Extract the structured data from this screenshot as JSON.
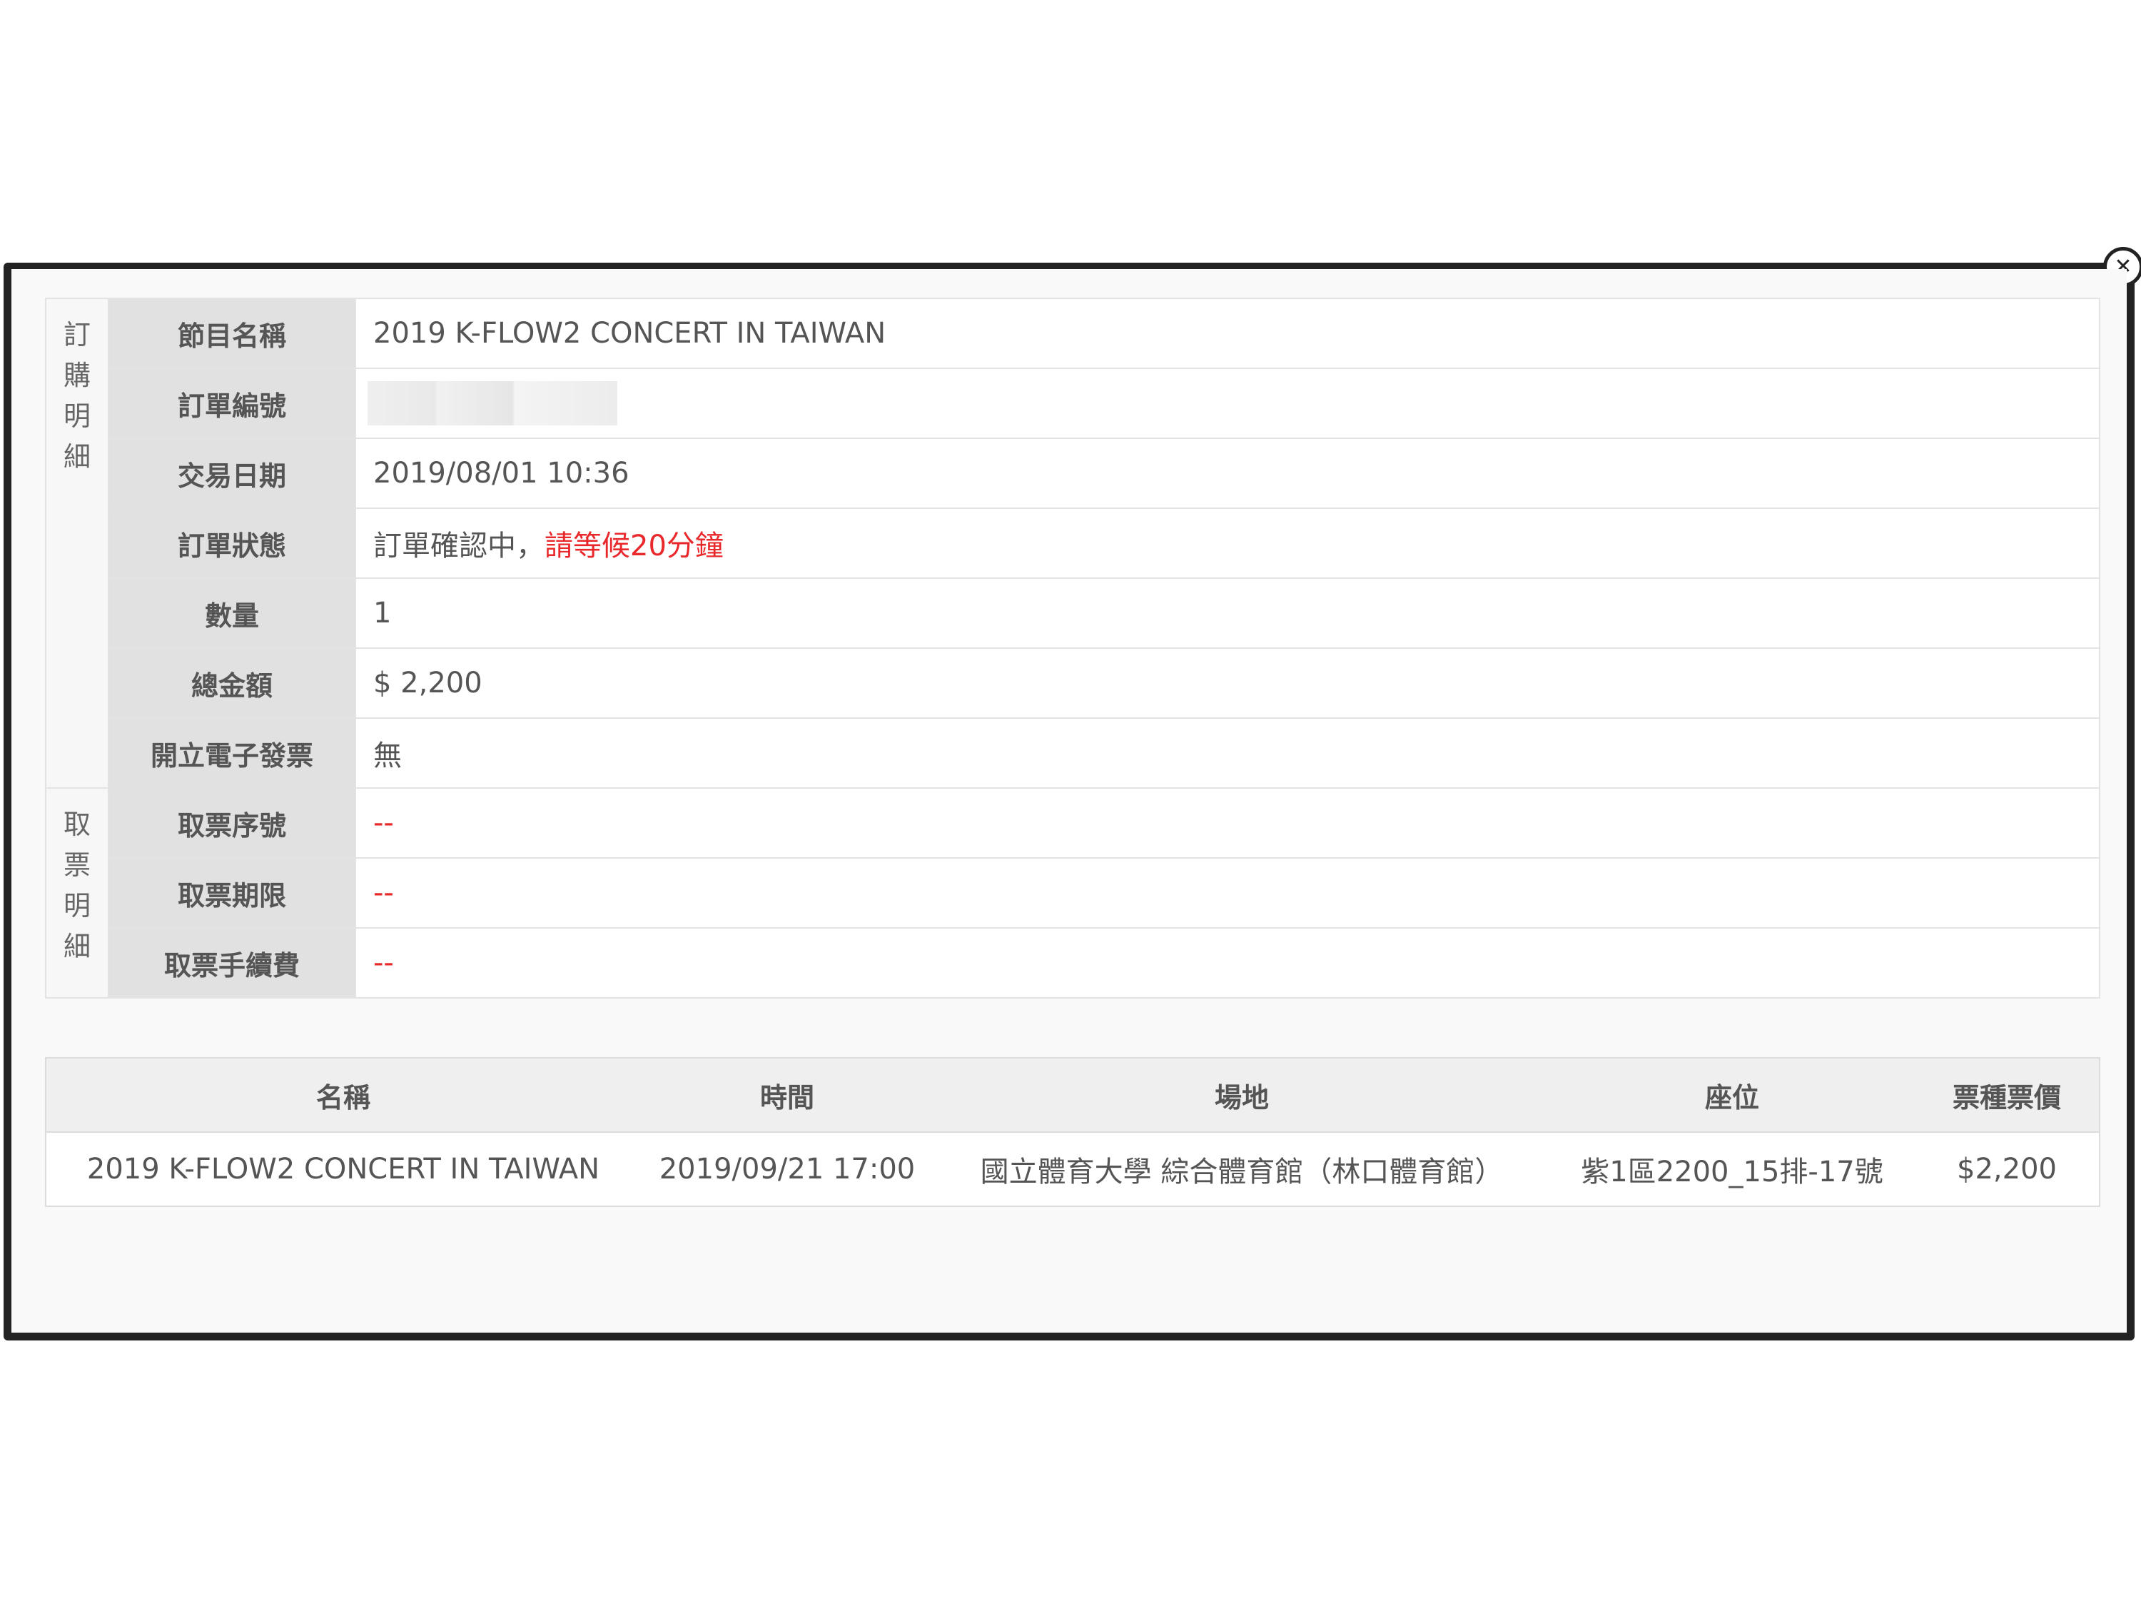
{
  "order": {
    "group_label_chars": [
      "訂",
      "購",
      "明",
      "細"
    ],
    "program_label": "節目名稱",
    "program_value": "2019 K-FLOW2 CONCERT IN TAIWAN",
    "order_no_label": "訂單編號",
    "date_label": "交易日期",
    "date_value": "2019/08/01 10:36",
    "status_label": "訂單狀態",
    "status_value": "訂單確認中，",
    "status_wait": "請等候20分鐘",
    "qty_label": "數量",
    "qty_value": "1",
    "total_label": "總金額",
    "total_value": "$ 2,200",
    "invoice_label": "開立電子發票",
    "invoice_value": "無"
  },
  "pickup": {
    "group_label_chars": [
      "取",
      "票",
      "明",
      "細"
    ],
    "serial_label": "取票序號",
    "serial_value": "--",
    "deadline_label": "取票期限",
    "deadline_value": "--",
    "fee_label": "取票手續費",
    "fee_value": "--"
  },
  "items": {
    "headers": [
      "名稱",
      "時間",
      "場地",
      "座位",
      "票種票價"
    ],
    "rows": [
      [
        "2019 K-FLOW2 CONCERT IN TAIWAN",
        "2019/09/21 17:00",
        "國立體育大學 綜合體育館（林口體育館）",
        "紫1區2200_15排-17號",
        "$2,200"
      ]
    ]
  },
  "colors": {
    "accent_red": "#e8282a",
    "label_bg": "#e1e1e1",
    "header_bg": "#efefef"
  },
  "icons": {
    "close": "close-icon"
  }
}
